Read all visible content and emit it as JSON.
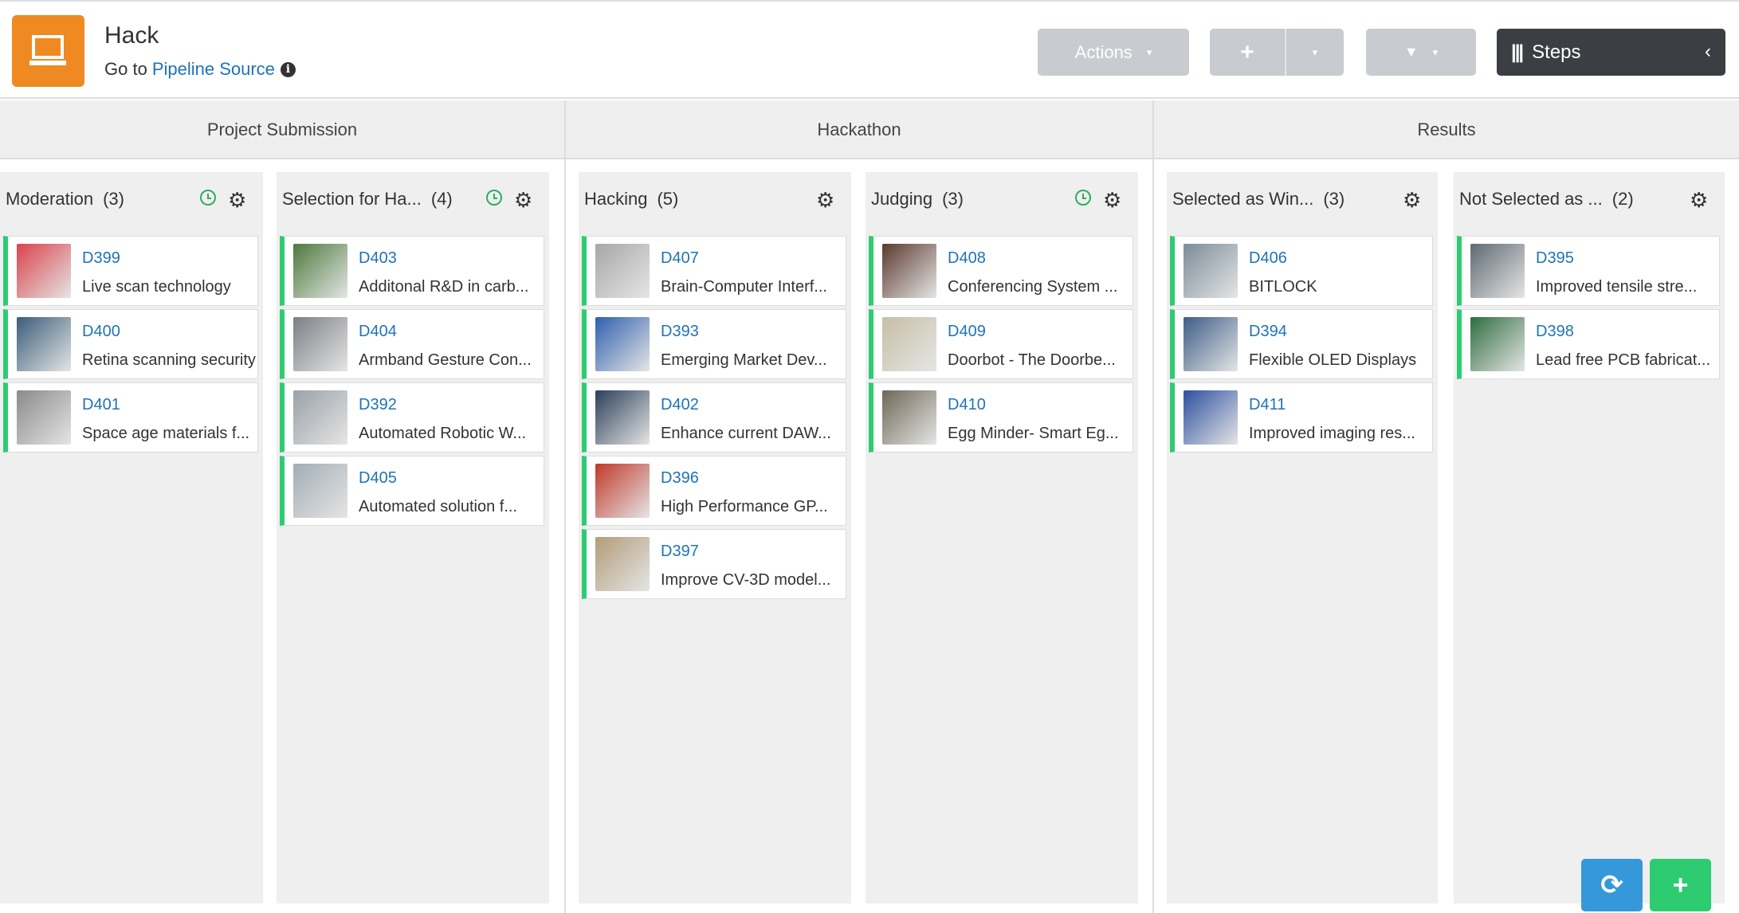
{
  "app": {
    "title": "Hack",
    "goto_prefix": "Go to",
    "goto_link": "Pipeline Source",
    "info_glyph": "i",
    "logo_icon": "laptop-icon"
  },
  "toolbar": {
    "actions_label": "Actions",
    "caret": "▾",
    "add_glyph": "+",
    "filter_glyph": "▼",
    "steps_label": "Steps",
    "steps_glyph": "|||",
    "chevron": "‹"
  },
  "stages": [
    {
      "title": "Project Submission"
    },
    {
      "title": "Hackathon"
    },
    {
      "title": "Results"
    }
  ],
  "columns": [
    {
      "name": "Moderation",
      "count": "(3)",
      "timer": true,
      "cards": [
        {
          "id": "D399",
          "title": "Live scan technology"
        },
        {
          "id": "D400",
          "title": "Retina scanning security"
        },
        {
          "id": "D401",
          "title": "Space age materials f..."
        }
      ]
    },
    {
      "name": "Selection for Ha...",
      "count": "(4)",
      "timer": true,
      "cards": [
        {
          "id": "D403",
          "title": "Additonal R&D in carb..."
        },
        {
          "id": "D404",
          "title": "Armband Gesture Con..."
        },
        {
          "id": "D392",
          "title": "Automated Robotic W..."
        },
        {
          "id": "D405",
          "title": "Automated solution f..."
        }
      ]
    },
    {
      "name": "Hacking",
      "count": "(5)",
      "timer": false,
      "cards": [
        {
          "id": "D407",
          "title": "Brain-Computer Interf..."
        },
        {
          "id": "D393",
          "title": "Emerging Market Dev..."
        },
        {
          "id": "D402",
          "title": "Enhance current DAW..."
        },
        {
          "id": "D396",
          "title": "High Performance GP..."
        },
        {
          "id": "D397",
          "title": "Improve CV-3D model..."
        }
      ]
    },
    {
      "name": "Judging",
      "count": "(3)",
      "timer": true,
      "cards": [
        {
          "id": "D408",
          "title": "Conferencing System ..."
        },
        {
          "id": "D409",
          "title": "Doorbot - The Doorbe..."
        },
        {
          "id": "D410",
          "title": "Egg Minder- Smart Eg..."
        }
      ]
    },
    {
      "name": "Selected as Win...",
      "count": "(3)",
      "timer": false,
      "cards": [
        {
          "id": "D406",
          "title": "BITLOCK"
        },
        {
          "id": "D394",
          "title": "Flexible OLED Displays"
        },
        {
          "id": "D411",
          "title": "Improved imaging res..."
        }
      ]
    },
    {
      "name": "Not Selected as ...",
      "count": "(2)",
      "timer": false,
      "cards": [
        {
          "id": "D395",
          "title": "Improved tensile stre..."
        },
        {
          "id": "D398",
          "title": "Lead free PCB fabricat..."
        }
      ]
    }
  ],
  "fab": {
    "refresh_glyph": "⟳",
    "add_glyph": "+"
  },
  "colors": {
    "accent": "#ef8a22",
    "link": "#1f73b7",
    "card_border": "#2ecc71",
    "refresh": "#3498db",
    "add": "#2ecc71"
  }
}
